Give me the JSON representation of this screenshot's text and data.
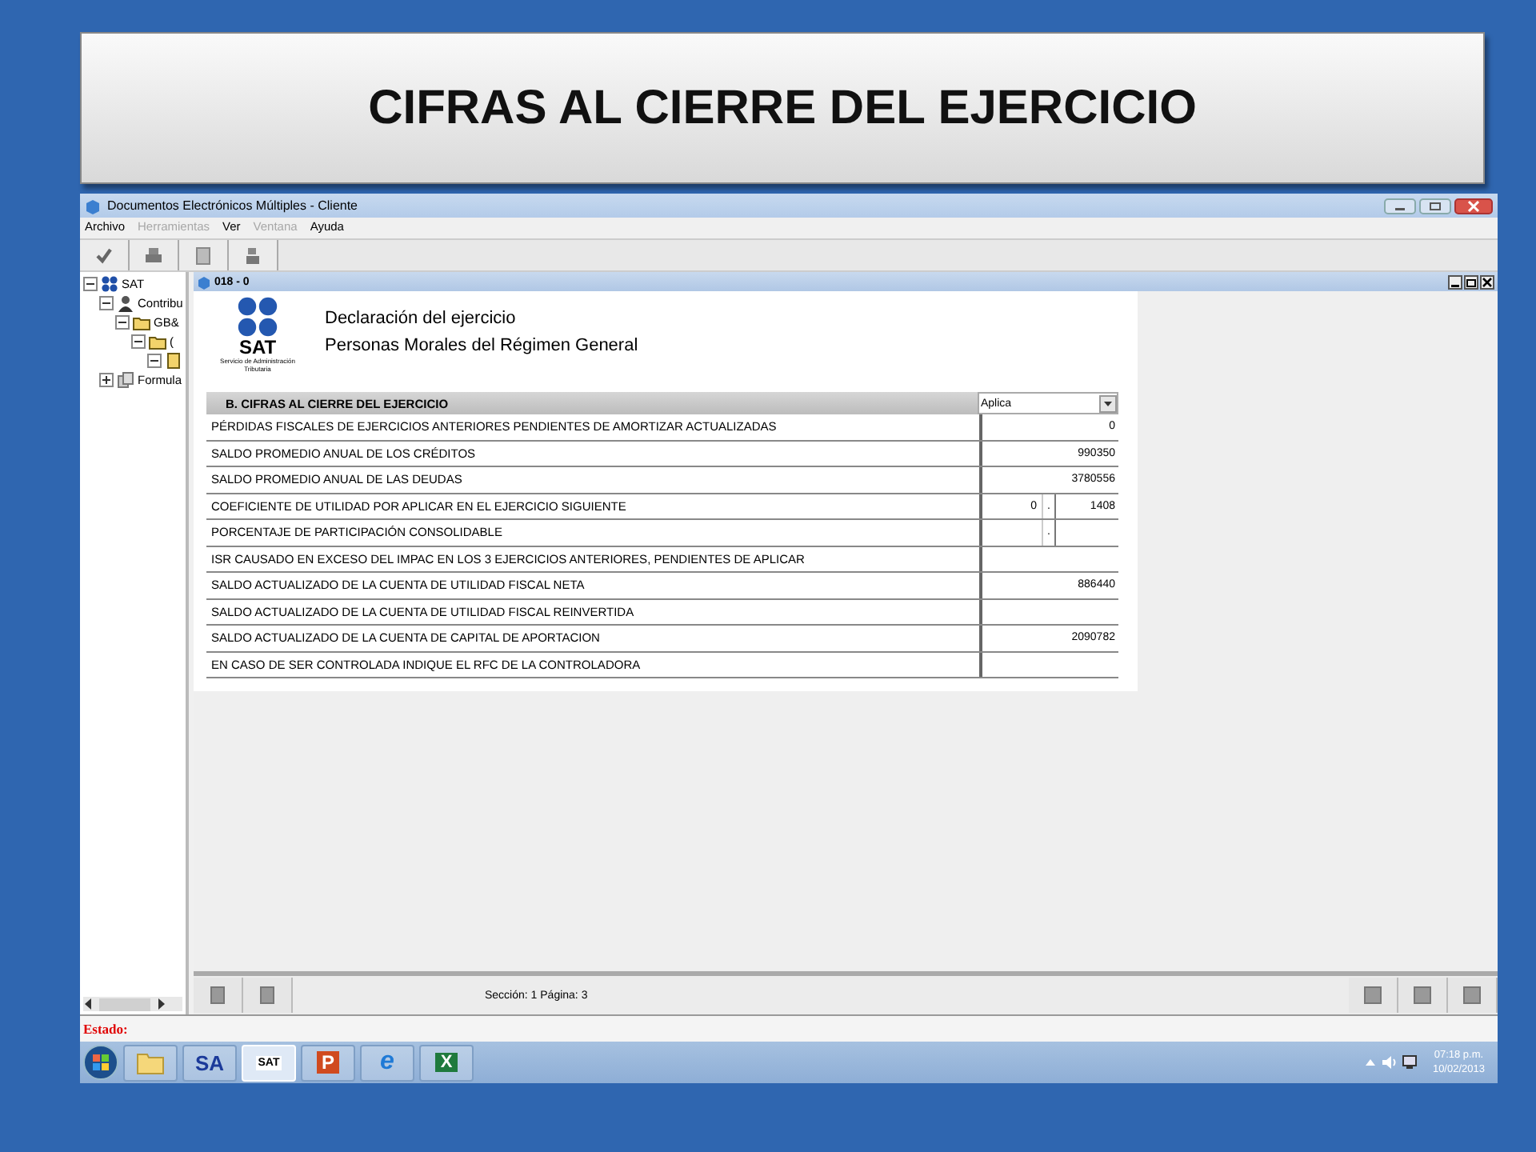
{
  "slide_title": "CIFRAS AL CIERRE DEL EJERCICIO",
  "window": {
    "title": "Documentos Electrónicos Múltiples - Cliente"
  },
  "menu": [
    {
      "label": "Archivo",
      "disabled": false
    },
    {
      "label": "Herramientas",
      "disabled": true
    },
    {
      "label": "Ver",
      "disabled": false
    },
    {
      "label": "Ventana",
      "disabled": true
    },
    {
      "label": "Ayuda",
      "disabled": false
    }
  ],
  "toolbar": [
    {
      "kind": "check"
    },
    {
      "kind": "print"
    },
    {
      "kind": "page"
    },
    {
      "kind": "stamp"
    }
  ],
  "tree": [
    {
      "label": "SAT",
      "kind": "sat",
      "expanded": true,
      "children": [
        {
          "label": "Contribu",
          "kind": "person",
          "expanded": true,
          "children": [
            {
              "label": "GB&",
              "kind": "folder",
              "expanded": true,
              "children": [
                {
                  "label": "(",
                  "kind": "folder",
                  "expanded": true,
                  "children": [
                    {
                      "kind": "leaf",
                      "expanded": true
                    }
                  ]
                }
              ]
            }
          ]
        },
        {
          "label": "Formula",
          "kind": "doc",
          "expanded": false
        }
      ]
    }
  ],
  "document": {
    "title": "018 - 0",
    "logo": {
      "text": "SAT",
      "subtitle": "Servicio de Administración Tributaria"
    },
    "heading": "Declaración del ejercicio",
    "subheading": "Personas Morales del Régimen General",
    "section": {
      "title": "B. CIFRAS AL CIERRE DEL EJERCICIO",
      "dropdown": "Aplica"
    },
    "rows": [
      {
        "label": "PÉRDIDAS FISCALES DE EJERCICIOS ANTERIORES PENDIENTES DE AMORTIZAR ACTUALIZADAS",
        "kind": "amount",
        "value": "0"
      },
      {
        "label": "SALDO PROMEDIO ANUAL DE LOS CRÉDITOS",
        "kind": "amount",
        "value": "990350"
      },
      {
        "label": "SALDO PROMEDIO ANUAL DE LAS DEUDAS",
        "kind": "amount",
        "value": "3780556"
      },
      {
        "label": "COEFICIENTE DE UTILIDAD POR APLICAR EN EL EJERCICIO SIGUIENTE",
        "kind": "decimal",
        "integer": "0",
        "separator": ".",
        "fraction": "1408"
      },
      {
        "label": "PORCENTAJE DE PARTICIPACIÓN CONSOLIDABLE",
        "kind": "decimal",
        "separator": "."
      },
      {
        "label": "ISR CAUSADO EN EXCESO DEL IMPAC EN LOS 3 EJERCICIOS ANTERIORES, PENDIENTES DE APLICAR",
        "kind": "amount"
      },
      {
        "label": "SALDO ACTUALIZADO DE LA CUENTA DE UTILIDAD FISCAL NETA",
        "kind": "amount",
        "value": "886440"
      },
      {
        "label": "SALDO ACTUALIZADO DE LA CUENTA DE UTILIDAD FISCAL REINVERTIDA",
        "kind": "amount"
      },
      {
        "label": "SALDO ACTUALIZADO DE LA CUENTA DE CAPITAL DE APORTACION",
        "kind": "amount",
        "value": "2090782"
      },
      {
        "label": "EN CASO DE SER CONTROLADA INDIQUE EL RFC DE LA CONTROLADORA",
        "kind": "amount"
      }
    ],
    "footer": "Sección: 1  Página: 3"
  },
  "status": {
    "label": "Estado:"
  },
  "taskbar": [
    {
      "kind": "folder",
      "selected": false
    },
    {
      "kind": "sa",
      "text": "SA",
      "selected": false
    },
    {
      "kind": "sat",
      "text": "SAT",
      "selected": true
    },
    {
      "kind": "powerpoint",
      "text": "P",
      "selected": false
    },
    {
      "kind": "ie",
      "text": "e",
      "selected": false
    },
    {
      "kind": "excel",
      "text": "X",
      "selected": false
    }
  ],
  "clock": {
    "time": "07:18 p.m.",
    "date": "10/02/2013"
  }
}
